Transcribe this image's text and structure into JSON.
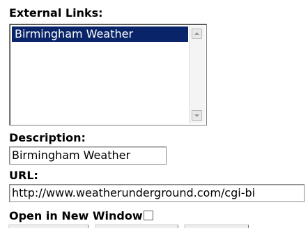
{
  "external_links": {
    "label": "External Links:",
    "items": [
      {
        "label": "Birmingham Weather",
        "selected": true
      }
    ]
  },
  "description": {
    "label": "Description:",
    "value": "Birmingham Weather"
  },
  "url": {
    "label": "URL:",
    "value": "http://www.weatherunderground.com/cgi-bi"
  },
  "new_window": {
    "label": "Open in New Window",
    "checked": false
  },
  "icons": {
    "scroll_up": "scroll-up-arrow-icon",
    "scroll_down": "scroll-down-arrow-icon"
  },
  "colors": {
    "selection_background": "#0a246a",
    "selection_text": "#ffffff"
  }
}
